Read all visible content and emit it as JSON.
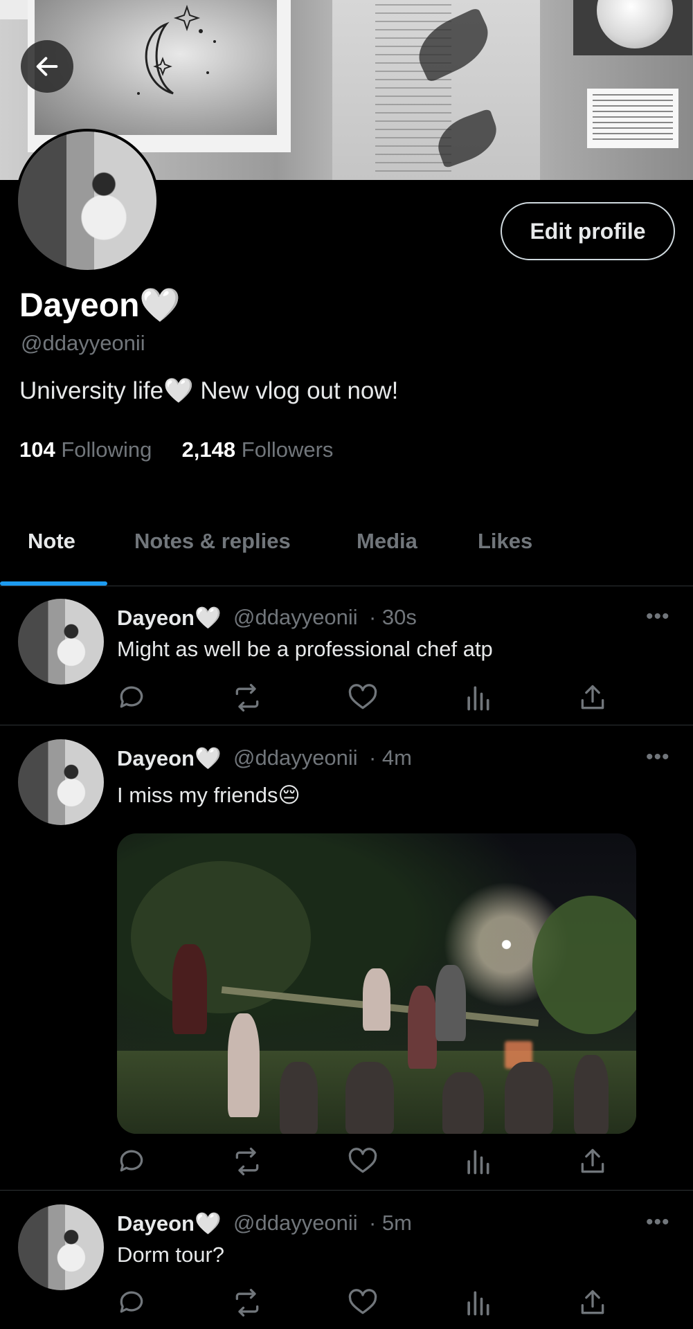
{
  "profile": {
    "display_name": "Dayeon🤍",
    "handle": "@ddayyeonii",
    "bio": "University life🤍  New vlog out now!",
    "following_count": "104",
    "following_label": "Following",
    "followers_count": "2,148",
    "followers_label": "Followers",
    "edit_profile_label": "Edit profile"
  },
  "tabs": [
    {
      "label": "Note",
      "active": true
    },
    {
      "label": "Notes & replies",
      "active": false
    },
    {
      "label": "Media",
      "active": false
    },
    {
      "label": "Likes",
      "active": false
    }
  ],
  "tweets": [
    {
      "name": "Dayeon🤍",
      "handle": "@ddayyeonii",
      "time": "· 30s",
      "text": "Might as well be a professional chef atp",
      "has_image": false
    },
    {
      "name": "Dayeon🤍",
      "handle": "@ddayyeonii",
      "time": "· 4m",
      "text": "I miss my friends😔",
      "has_image": true
    },
    {
      "name": "Dayeon🤍",
      "handle": "@ddayyeonii",
      "time": "· 5m",
      "text": "Dorm tour?",
      "has_image": false
    }
  ],
  "more_label": "•••",
  "icons": {
    "back": "arrow-left-icon",
    "reply": "reply-icon",
    "retweet": "retweet-icon",
    "like": "heart-icon",
    "views": "views-icon",
    "share": "share-icon"
  },
  "colors": {
    "background": "#000000",
    "text_primary": "#e7e9ea",
    "text_secondary": "#71767b",
    "accent": "#1d9bf0",
    "divider": "#2f3336"
  }
}
